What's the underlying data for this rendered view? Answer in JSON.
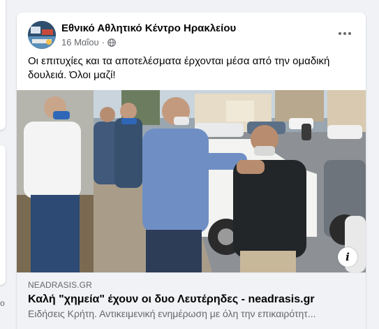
{
  "post": {
    "page_name": "Εθνικό Αθλητικό Κέντρο Ηρακλείου",
    "date": "16 Μαΐου",
    "dot": "·",
    "privacy_icon": "globe-icon",
    "more_icon": "more-options-icon",
    "message": "Οι επιτυχίες και τα αποτελέσματα έρχονται μέσα από την ομαδική δουλειά. Όλοι μαζί!",
    "photo_info_label": "i",
    "link": {
      "domain": "NEADRASIS.GR",
      "title": "Καλή \"χημεία\" έχουν οι δυο Λευτέρηδες - neadrasis.gr",
      "description": "Ειδήσεις Κρήτη. Αντικειμενική ενημέρωση με όλη την επικαιρότητ..."
    }
  },
  "left_edge": {
    "text": "o"
  },
  "colors": {
    "background": "#f0f2f5",
    "card": "#ffffff",
    "secondary_text": "#65676b",
    "primary_text": "#050505"
  }
}
